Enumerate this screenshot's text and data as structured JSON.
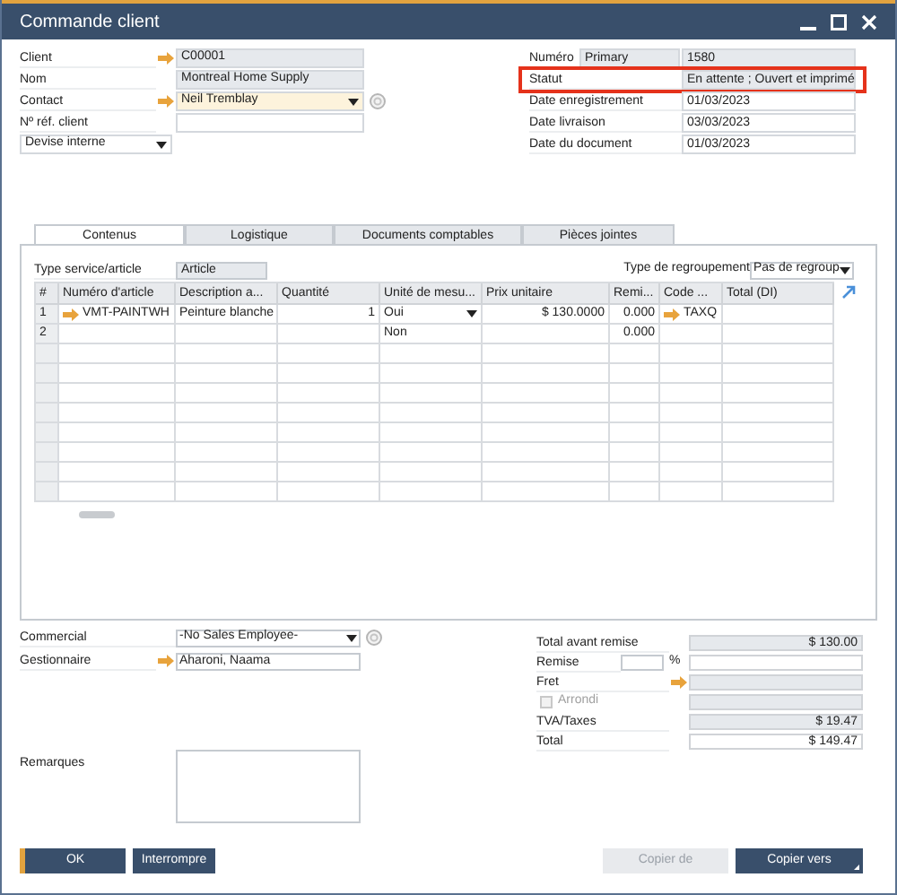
{
  "window": {
    "title": "Commande client"
  },
  "header_left": [
    {
      "label": "Client",
      "value": "C00001",
      "kind": "link"
    },
    {
      "label": "Nom",
      "value": "Montreal Home Supply",
      "kind": "readonly"
    },
    {
      "label": "Contact",
      "value": "Neil Tremblay",
      "kind": "link-dropdown"
    },
    {
      "label": "Nº réf. client",
      "kind": "input"
    }
  ],
  "currency": {
    "value": "Devise interne"
  },
  "header_right": [
    {
      "label": "Numéro",
      "series": "Primary",
      "value": "1580",
      "kind": "numbered",
      "highlighted": false
    },
    {
      "label": "Statut",
      "value": "En attente ; Ouvert et imprimé",
      "kind": "readonly",
      "highlighted": true
    },
    {
      "label": "Date enregistrement",
      "value": "01/03/2023",
      "kind": "input",
      "highlighted": false
    },
    {
      "label": "Date livraison",
      "value": "03/03/2023",
      "kind": "input",
      "highlighted": false
    },
    {
      "label": "Date du document",
      "value": "01/03/2023",
      "kind": "input",
      "highlighted": false
    }
  ],
  "tabs": [
    {
      "label": "Contenus",
      "selected": true
    },
    {
      "label": "Logistique",
      "selected": false
    },
    {
      "label": "Documents comptables",
      "selected": false
    },
    {
      "label": "Pièces jointes",
      "selected": false
    }
  ],
  "item_type": {
    "label": "Type service/article",
    "value": "Article"
  },
  "grouping": {
    "label": "Type de regroupement",
    "value": "Pas de regroup"
  },
  "table": {
    "columns": [
      {
        "label": "#",
        "kind": "index"
      },
      {
        "label": "Numéro d'article",
        "kind": "link"
      },
      {
        "label": "Description a...",
        "kind": "text"
      },
      {
        "label": "Quantité",
        "kind": "number"
      },
      {
        "label": "Unité de mesu...",
        "kind": "uom"
      },
      {
        "label": "Prix unitaire",
        "kind": "number"
      },
      {
        "label": "Remi...",
        "kind": "number"
      },
      {
        "label": "Code ...",
        "kind": "link"
      },
      {
        "label": "Total (DI)",
        "kind": "number"
      }
    ],
    "rows": [
      {
        "selected": true,
        "cells": [
          "1",
          "VMT-PAINTWH",
          "Peinture blanche",
          "1",
          "Oui",
          "$ 130.0000",
          "0.000",
          "TAXQ",
          null
        ]
      },
      {
        "selected": false,
        "cells": [
          "2",
          null,
          null,
          null,
          "Non",
          null,
          "0.000",
          null,
          null
        ]
      }
    ]
  },
  "sales_employee": {
    "label": "Commercial",
    "value": "-No Sales Employee-"
  },
  "owner": {
    "label": "Gestionnaire",
    "value": "Aharoni, Naama"
  },
  "remarks": {
    "label": "Remarques"
  },
  "totals": [
    {
      "label": "Total avant remise",
      "value": "$ 130.00",
      "kind": "readonly"
    },
    {
      "label": "Remise",
      "unit": "%",
      "kind": "discount"
    },
    {
      "label": "Fret",
      "kind": "link"
    },
    {
      "label": "Arrondi",
      "kind": "checkbox",
      "checked": false,
      "disabled": true
    },
    {
      "label": "TVA/Taxes",
      "value": "$ 19.47",
      "kind": "readonly"
    },
    {
      "label": "Total",
      "value": "$ 149.47",
      "kind": "input"
    }
  ],
  "buttons_left": [
    {
      "label": "OK",
      "kind": "primary"
    },
    {
      "label": "Interrompre",
      "kind": "secondary"
    }
  ],
  "buttons_right": [
    {
      "label": "Copier de",
      "kind": "disabled"
    },
    {
      "label": "Copier vers",
      "kind": "menu"
    }
  ]
}
